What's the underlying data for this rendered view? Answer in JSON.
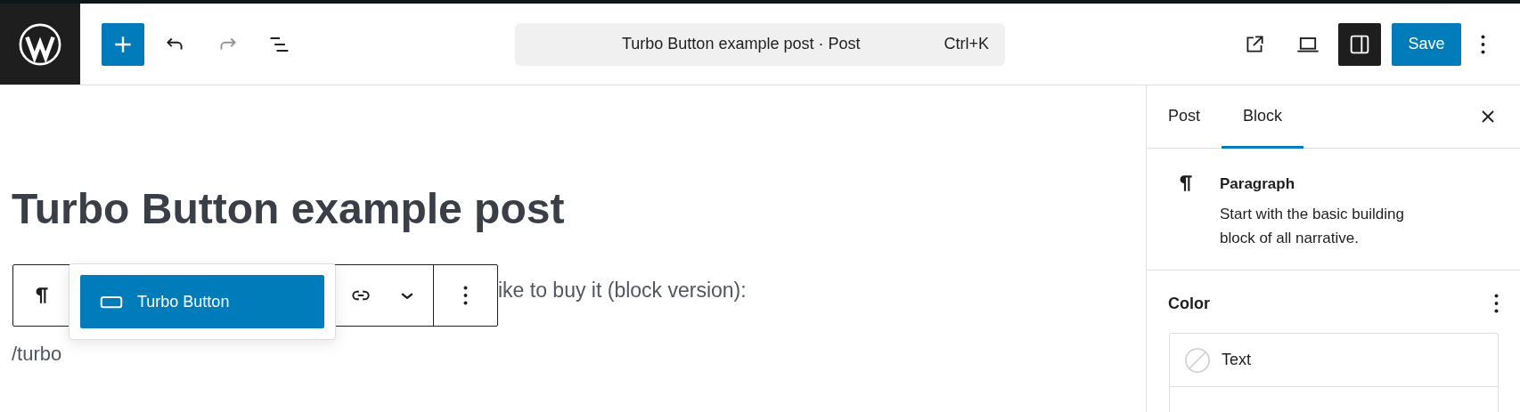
{
  "header": {
    "undo": {
      "disabled": false
    },
    "redo": {
      "disabled": true
    },
    "command_bar": {
      "title": "Turbo Button example post · Post",
      "shortcut": "Ctrl+K"
    },
    "sidebar_toggle": {
      "pressed": true
    },
    "save_label": "Save"
  },
  "editor": {
    "title": "Turbo Button example post",
    "paragraph": "ike to buy it (block version):",
    "draft_line": "/turbo",
    "inserter_popup": {
      "items": [
        {
          "label": "Turbo Button",
          "selected": true
        }
      ]
    }
  },
  "sidebar": {
    "tabs": [
      {
        "label": "Post",
        "selected": false
      },
      {
        "label": "Block",
        "selected": true
      }
    ],
    "block_card": {
      "title": "Paragraph",
      "description": "Start with the basic building block of all narrative."
    },
    "color_panel": {
      "title": "Color",
      "items": [
        {
          "label": "Text"
        }
      ]
    }
  }
}
